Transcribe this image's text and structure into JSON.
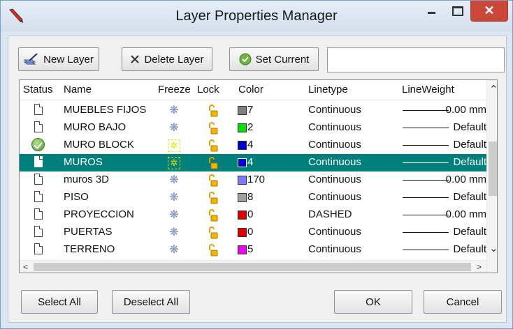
{
  "window": {
    "title": "Layer Properties Manager",
    "close_glyph": "✕"
  },
  "toolbar": {
    "new_layer": "New Layer",
    "delete_layer": "Delete Layer",
    "set_current": "Set Current",
    "filter_value": ""
  },
  "columns": {
    "status": "Status",
    "name": "Name",
    "freeze": "Freeze",
    "lock": "Lock",
    "color": "Color",
    "linetype": "Linetype",
    "lineweight": "LineWeight"
  },
  "layers": [
    {
      "name": "MUEBLES FIJOS",
      "status": "normal",
      "frozen": false,
      "color_num": "7",
      "color_hex": "#808080",
      "linetype": "Continuous",
      "lineweight": "0.00 mm",
      "selected": false
    },
    {
      "name": "MURO BAJO",
      "status": "normal",
      "frozen": false,
      "color_num": "2",
      "color_hex": "#00e000",
      "linetype": "Continuous",
      "lineweight": "Default",
      "selected": false
    },
    {
      "name": "MURO BLOCK",
      "status": "current",
      "frozen": true,
      "color_num": "4",
      "color_hex": "#0000cc",
      "linetype": "Continuous",
      "lineweight": "Default",
      "selected": false
    },
    {
      "name": "MUROS",
      "status": "normal",
      "frozen": true,
      "color_num": "4",
      "color_hex": "#0000cc",
      "linetype": "Continuous",
      "lineweight": "Default",
      "selected": true
    },
    {
      "name": "muros 3D",
      "status": "normal",
      "frozen": false,
      "color_num": "170",
      "color_hex": "#7a7aff",
      "linetype": "Continuous",
      "lineweight": "0.00 mm",
      "selected": false
    },
    {
      "name": "PISO",
      "status": "normal",
      "frozen": false,
      "color_num": "8",
      "color_hex": "#a0a0a0",
      "linetype": "Continuous",
      "lineweight": "Default",
      "selected": false
    },
    {
      "name": "PROYECCION",
      "status": "normal",
      "frozen": false,
      "color_num": "0",
      "color_hex": "#dd0000",
      "linetype": "DASHED",
      "lineweight": "0.00 mm",
      "selected": false
    },
    {
      "name": "PUERTAS",
      "status": "normal",
      "frozen": false,
      "color_num": "0",
      "color_hex": "#dd0000",
      "linetype": "Continuous",
      "lineweight": "Default",
      "selected": false
    },
    {
      "name": "TERRENO",
      "status": "normal",
      "frozen": false,
      "color_num": "5",
      "color_hex": "#ee00ee",
      "linetype": "Continuous",
      "lineweight": "Default",
      "selected": false
    }
  ],
  "icons": {
    "freeze": "snowflake-icon",
    "lock": "open-lock-icon",
    "status": "document-icon",
    "current": "check-circle-icon"
  },
  "scroll_glyphs": {
    "up": "⌃",
    "down": "⌄",
    "left": "<",
    "right": ">"
  },
  "footer": {
    "select_all": "Select All",
    "deselect_all": "Deselect All",
    "ok": "OK",
    "cancel": "Cancel"
  }
}
